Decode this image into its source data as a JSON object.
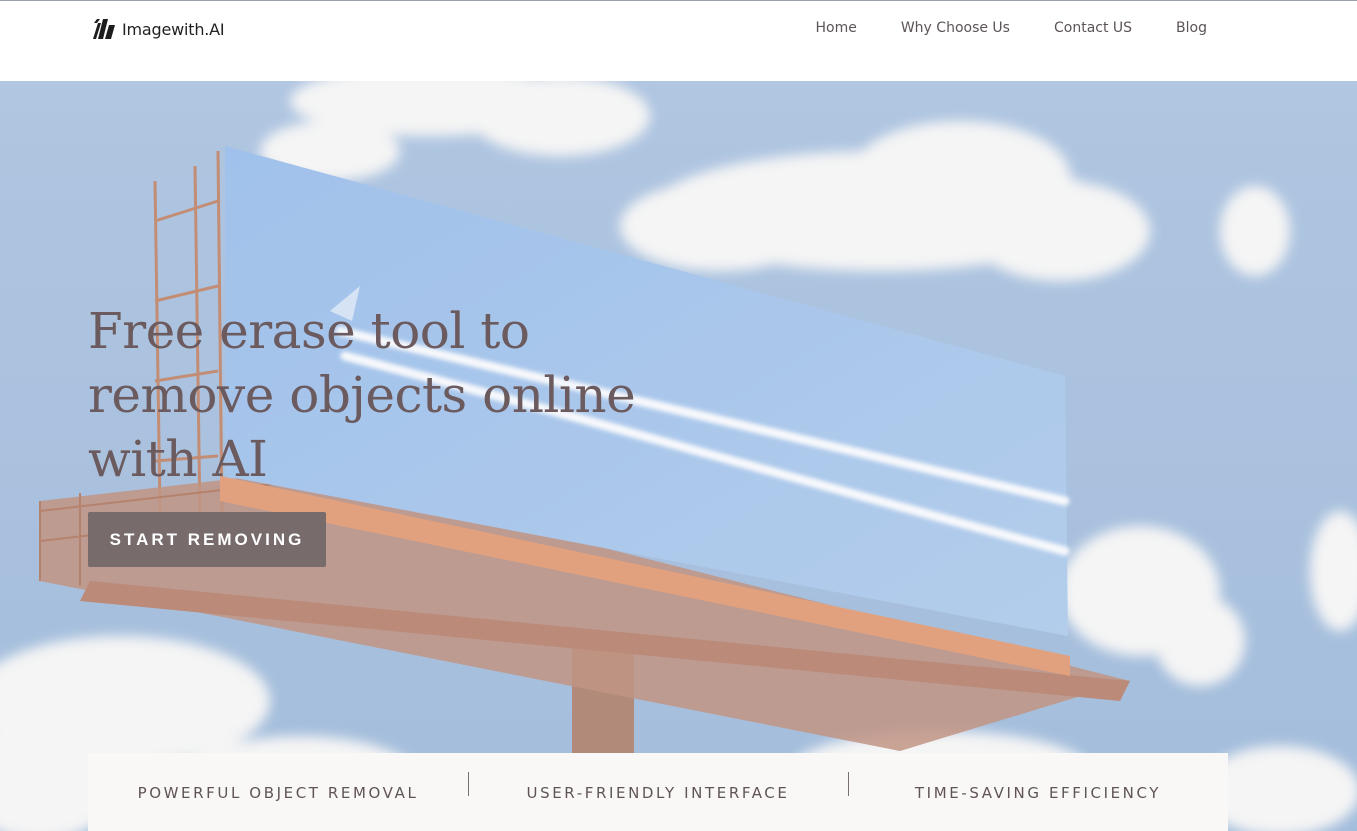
{
  "header": {
    "brand": "Imagewith.AI",
    "logo_icon": "slanted-stripes-logo-icon",
    "nav": [
      {
        "label": "Home"
      },
      {
        "label": "Why Choose Us"
      },
      {
        "label": "Contact US"
      },
      {
        "label": "Blog"
      }
    ]
  },
  "hero": {
    "title": "Free erase tool to remove objects online with AI",
    "cta_label": "START REMOVING",
    "background_image": "billboard-under-cloudy-sky-photo"
  },
  "features": [
    {
      "label": "POWERFUL OBJECT REMOVAL"
    },
    {
      "label": "USER-FRIENDLY INTERFACE"
    },
    {
      "label": "TIME-SAVING EFFICIENCY"
    }
  ],
  "colors": {
    "title_text": "#6b5a5e",
    "cta_background": "#776b6c",
    "features_background": "#faf8f6",
    "sky": "#8fb0d6",
    "billboard_panel": "#92b7e4",
    "billboard_frame": "#c9724b"
  }
}
